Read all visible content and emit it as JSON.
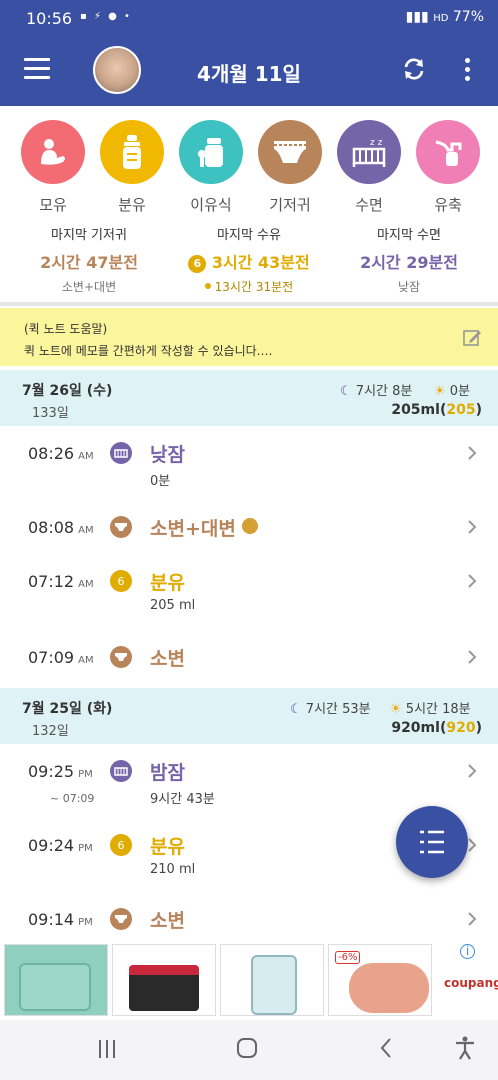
{
  "status_bar": {
    "time": "10:56",
    "battery": "77%",
    "hd_label": "HD"
  },
  "header": {
    "title": "4개월 11일"
  },
  "categories": [
    {
      "label": "모유",
      "color": "#f36b73"
    },
    {
      "label": "분유",
      "color": "#f0b800"
    },
    {
      "label": "이유식",
      "color": "#3ec1c1"
    },
    {
      "label": "기저귀",
      "color": "#b8845a"
    },
    {
      "label": "수면",
      "color": "#7464a8"
    },
    {
      "label": "유축",
      "color": "#f07fb5"
    }
  ],
  "summary": {
    "diaper": {
      "title": "마지막 기저귀",
      "value": "2시간 47분전",
      "sub": "소변+대변",
      "color": "#b8845a"
    },
    "feed": {
      "title": "마지막 수유",
      "value": "3시간 43분전",
      "sub": "13시간 31분전",
      "color": "#e1ac00"
    },
    "sleep": {
      "title": "마지막 수면",
      "value": "2시간 29분전",
      "sub": "낮잠",
      "color": "#7464a8"
    }
  },
  "quick_note": {
    "title": "(퀵 노트 도움말)",
    "body": "퀵 노트에 메모를 간편하게 작성할 수 있습니다.…"
  },
  "days": [
    {
      "date": "7월 26일 (수)",
      "day_count": "133일",
      "night_sleep": "7시간 8분",
      "day_sleep": "0분",
      "ml_total": "205ml",
      "ml_formula": "205",
      "entries": [
        {
          "time": "08:26",
          "ampm": "AM",
          "range": "",
          "name": "낮잠",
          "detail": "0분",
          "type": "sleep",
          "color": "#7464a8"
        },
        {
          "time": "08:08",
          "ampm": "AM",
          "range": "",
          "name": "소변+대변",
          "detail": "",
          "type": "diaper",
          "color": "#b8845a"
        },
        {
          "time": "07:12",
          "ampm": "AM",
          "range": "",
          "name": "분유",
          "detail": "205 ml",
          "type": "formula",
          "color": "#e1ac00"
        },
        {
          "time": "07:09",
          "ampm": "AM",
          "range": "",
          "name": "소변",
          "detail": "",
          "type": "diaper",
          "color": "#b8845a"
        }
      ]
    },
    {
      "date": "7월 25일 (화)",
      "day_count": "132일",
      "night_sleep": "7시간 53분",
      "day_sleep": "5시간 18분",
      "ml_total": "920ml",
      "ml_formula": "920",
      "entries": [
        {
          "time": "09:25",
          "ampm": "PM",
          "range": "~ 07:09",
          "name": "밤잠",
          "detail": "9시간 43분",
          "type": "sleep",
          "color": "#7464a8"
        },
        {
          "time": "09:24",
          "ampm": "PM",
          "range": "",
          "name": "분유",
          "detail": "210 ml",
          "type": "formula",
          "color": "#e1ac00"
        },
        {
          "time": "09:14",
          "ampm": "PM",
          "range": "",
          "name": "소변",
          "detail": "",
          "type": "diaper",
          "color": "#b8845a"
        }
      ]
    }
  ],
  "ad": {
    "discount": "-6%",
    "brand": "coupang"
  }
}
